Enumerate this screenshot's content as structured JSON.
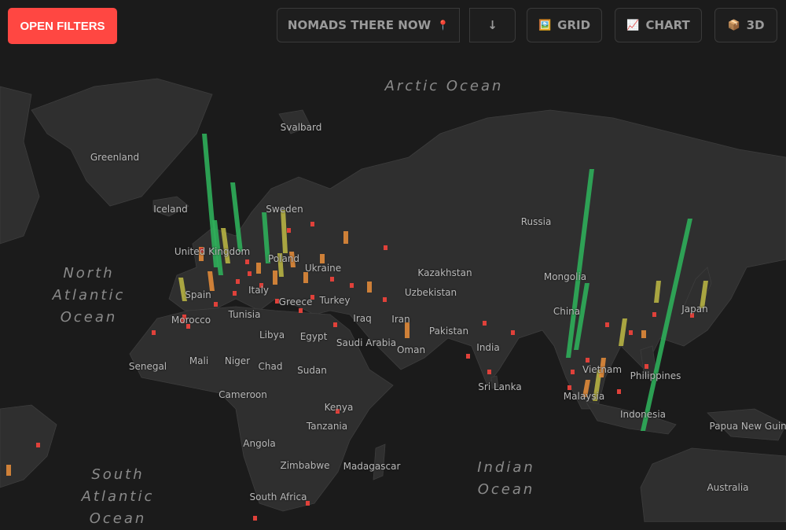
{
  "toolbar": {
    "open_filters": "OPEN FILTERS",
    "sort_label": "NOMADS THERE NOW",
    "sort_icon": "📍",
    "sort_direction": "↓",
    "grid": {
      "icon": "🖼️",
      "label": "GRID"
    },
    "chart": {
      "icon": "📈",
      "label": "CHART"
    },
    "three_d": {
      "icon": "📦",
      "label": "3D"
    }
  },
  "oceans": {
    "arctic": "Arctic Ocean",
    "north_atlantic": [
      "North",
      "Atlantic",
      "Ocean"
    ],
    "south_atlantic": [
      "South",
      "Atlantic",
      "Ocean"
    ],
    "indian": [
      "Indian",
      "Ocean"
    ]
  },
  "labels": {
    "greenland": "Greenland",
    "svalbard": "Svalbard",
    "iceland": "Iceland",
    "sweden": "Sweden",
    "russia": "Russia",
    "united_kingdom": "United Kingdom",
    "poland": "Poland",
    "ukraine": "Ukraine",
    "kazakhstan": "Kazakhstan",
    "mongolia": "Mongolia",
    "spain": "Spain",
    "italy": "Italy",
    "greece": "Greece",
    "turkey": "Turkey",
    "uzbekistan": "Uzbekistan",
    "china": "China",
    "japan": "Japan",
    "morocco": "Morocco",
    "tunisia": "Tunisia",
    "iraq": "Iraq",
    "iran": "Iran",
    "libya": "Libya",
    "egypt": "Egypt",
    "saudi_arabia": "Saudi Arabia",
    "oman": "Oman",
    "pakistan": "Pakistan",
    "india": "India",
    "senegal": "Senegal",
    "mali": "Mali",
    "niger": "Niger",
    "chad": "Chad",
    "sudan": "Sudan",
    "vietnam": "Vietnam",
    "philippines": "Philippines",
    "sri_lanka": "Sri Lanka",
    "malaysia": "Malaysia",
    "cameroon": "Cameroon",
    "kenya": "Kenya",
    "tanzania": "Tanzania",
    "indonesia": "Indonesia",
    "papua_new_guinea": "Papua New Guinea",
    "angola": "Angola",
    "zimbabwe": "Zimbabwe",
    "madagascar": "Madagascar",
    "south_africa": "South Africa",
    "australia": "Australia"
  },
  "colors": {
    "accent": "#ff4742",
    "land": "#2f2f2f",
    "water": "#1b1b1b",
    "bar_high": "#2fae5a",
    "bar_mid": "#b7b244",
    "bar_low": "#e08a3a",
    "bar_min": "#e0413a"
  }
}
